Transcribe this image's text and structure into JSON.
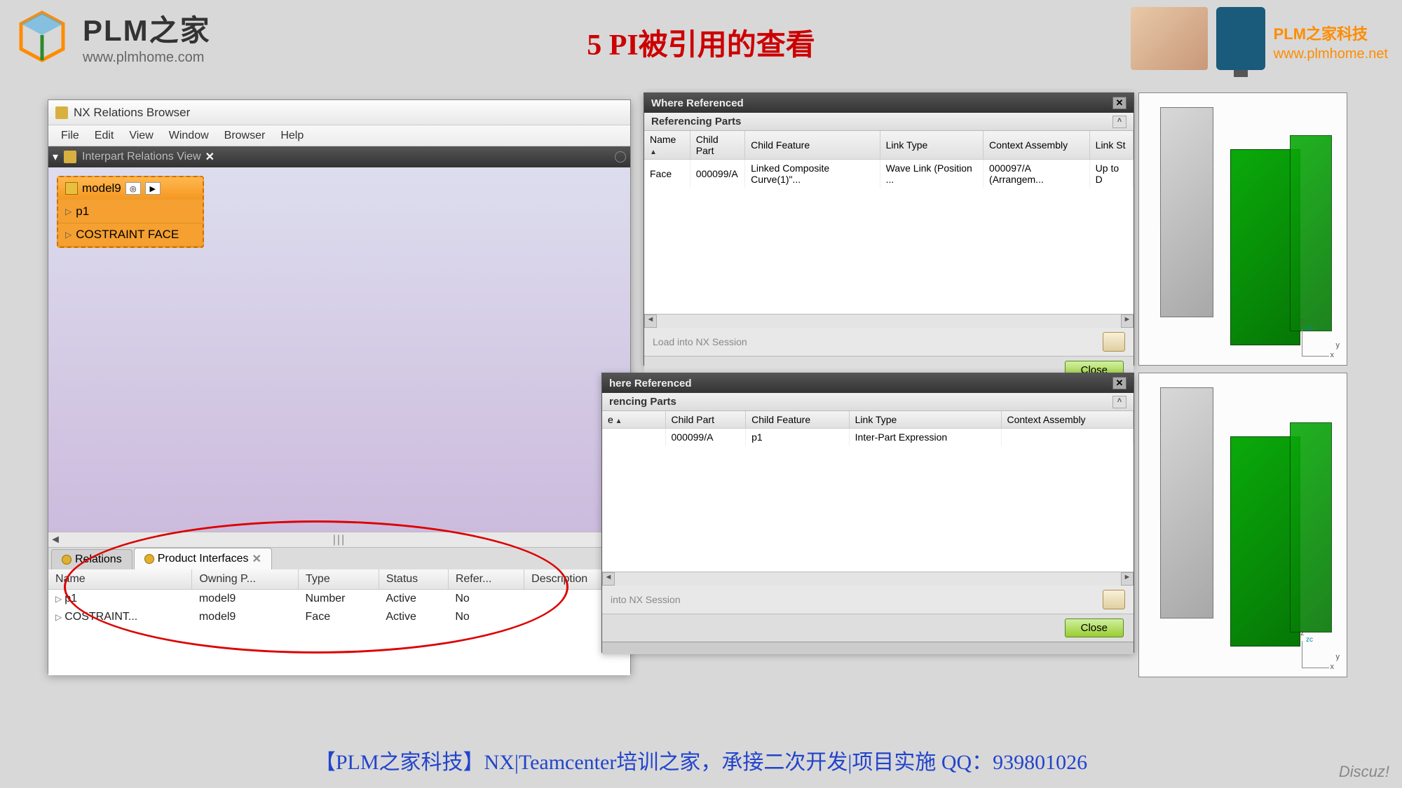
{
  "header": {
    "logo_title": "PLM之家",
    "logo_url": "www.plmhome.com",
    "main_title": "5 PI被引用的查看",
    "right_title": "PLM",
    "right_sub": "之家科技",
    "right_url": "www.plmhome.net"
  },
  "nx": {
    "window_title": "NX Relations Browser",
    "menu": [
      "File",
      "Edit",
      "View",
      "Window",
      "Browser",
      "Help"
    ],
    "toolbar_label": "Interpart Relations View",
    "tree": {
      "root": "model9",
      "children": [
        "p1",
        "COSTRAINT FACE"
      ]
    },
    "tabs": {
      "relations": "Relations",
      "product_interfaces": "Product Interfaces"
    },
    "pi_table": {
      "headers": [
        "Name",
        "Owning P...",
        "Type",
        "Status",
        "Refer...",
        "Description"
      ],
      "rows": [
        {
          "name": "p1",
          "owning": "model9",
          "type": "Number",
          "status": "Active",
          "refer": "No",
          "desc": ""
        },
        {
          "name": "COSTRAINT...",
          "owning": "model9",
          "type": "Face",
          "status": "Active",
          "refer": "No",
          "desc": ""
        }
      ]
    }
  },
  "ref1": {
    "title": "Where Referenced",
    "section": "Referencing Parts",
    "headers": [
      "Name",
      "Child Part",
      "Child Feature",
      "Link Type",
      "Context Assembly",
      "Link St"
    ],
    "row": {
      "name": "Face",
      "child_part": "000099/A",
      "child_feature": "Linked Composite Curve(1)\"...",
      "link_type": "Wave Link (Position ...",
      "context": "000097/A (Arrangem...",
      "link_st": "Up to D"
    },
    "load_label": "Load into NX Session",
    "close": "Close"
  },
  "ref2": {
    "title": "here Referenced",
    "section": "rencing Parts",
    "headers": [
      "e",
      "Child Part",
      "Child Feature",
      "Link Type",
      "Context Assembly"
    ],
    "row": {
      "name": "",
      "child_part": "000099/A",
      "child_feature": "p1",
      "link_type": "Inter-Part Expression",
      "context": ""
    },
    "load_label": "into NX Session",
    "close": "Close"
  },
  "footer": "【PLM之家科技】NX|Teamcenter培训之家，承接二次开发|项目实施 QQ：939801026",
  "watermark": "Discuz!"
}
